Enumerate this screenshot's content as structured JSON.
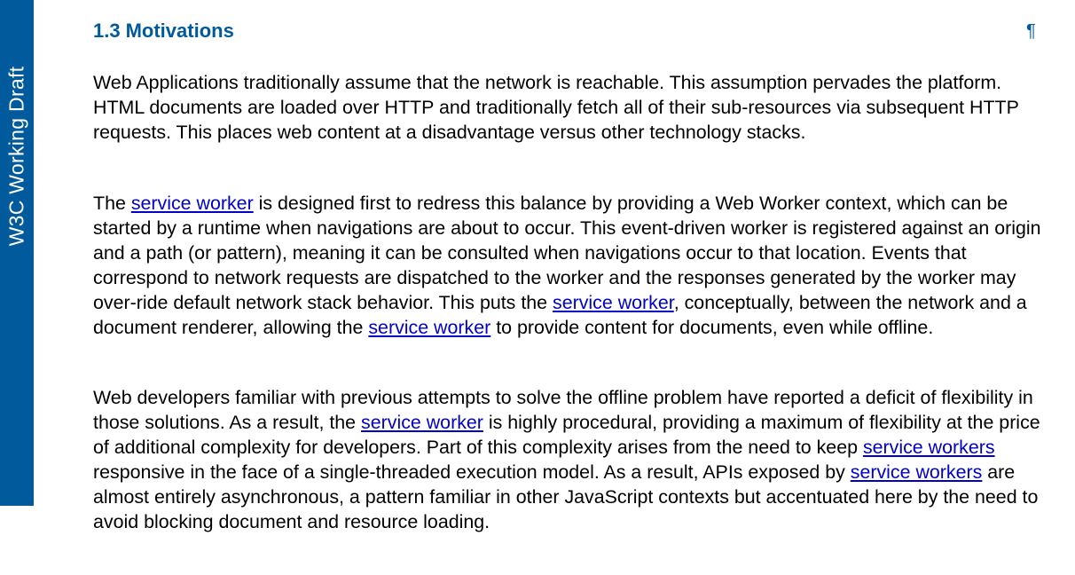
{
  "side_banner": {
    "text": "W3C Working Draft",
    "color": "#005a9c"
  },
  "section": {
    "number": "1.3",
    "title": "Motivations",
    "anchor_symbol": "¶",
    "heading_color": "#005a9c",
    "link_color": "#0000cc"
  },
  "paragraphs": [
    {
      "segments": [
        "Web Applications traditionally assume that the network is reachable. This assumption pervades the platform. HTML documents are loaded over HTTP and traditionally fetch all of their sub-resources via subsequent HTTP requests. This places web content at a disadvantage versus other technology stacks."
      ]
    },
    {
      "segments": [
        "The ",
        "service worker",
        " is designed first to redress this balance by providing a Web Worker context, which can be started by a runtime when navigations are about to occur. This event-driven worker is registered against an origin and a path (or pattern), meaning it can be consulted when navigations occur to that location. Events that correspond to network requests are dispatched to the worker and the responses generated by the worker may over-ride default network stack behavior. This puts the ",
        "service worker",
        ", conceptually, between the network and a document renderer, allowing the ",
        "service worker",
        " to provide content for documents, even while offline."
      ]
    },
    {
      "segments": [
        "Web developers familiar with previous attempts to solve the offline problem have reported a deficit of flexibility in those solutions. As a result, the ",
        "service worker",
        " is highly procedural, providing a maximum of flexibility at the price of additional complexity for developers. Part of this complexity arises from the need to keep ",
        "service workers",
        " responsive in the face of a single-threaded execution model. As a result, APIs exposed by ",
        "service workers",
        " are almost entirely asynchronous, a pattern familiar in other JavaScript contexts but accentuated here by the need to avoid blocking document and resource loading."
      ]
    }
  ]
}
